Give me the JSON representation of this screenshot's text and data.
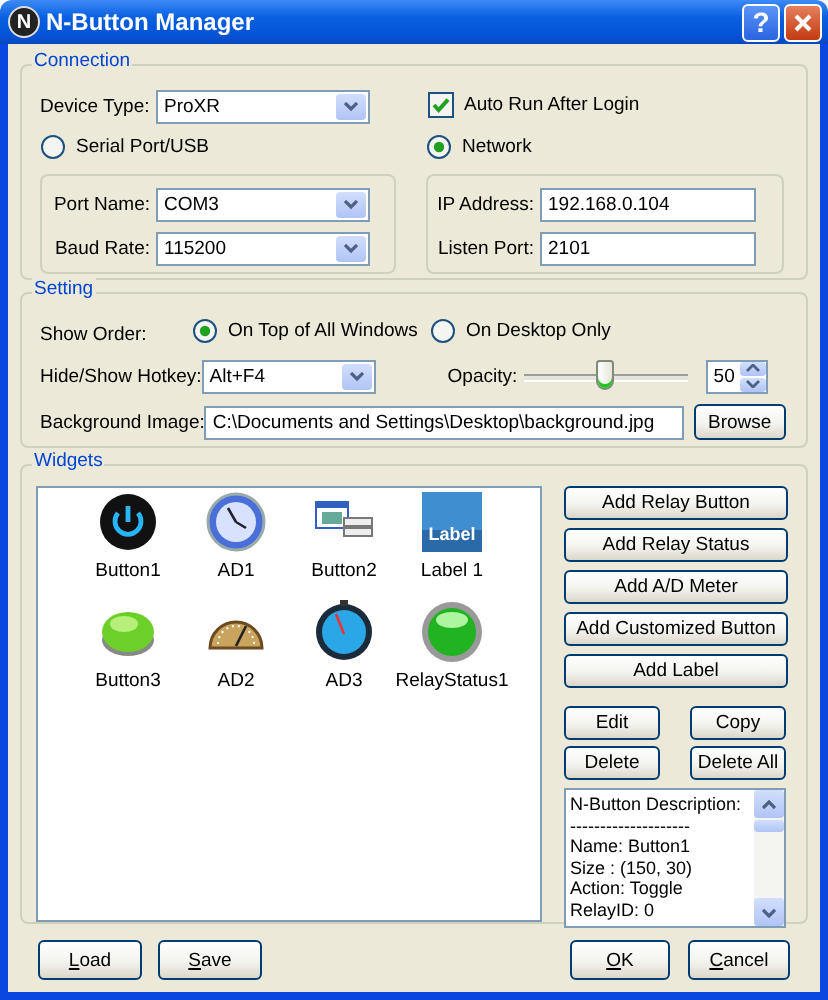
{
  "window": {
    "icon_letter": "N",
    "title": "N-Button Manager",
    "help": "?"
  },
  "connection": {
    "title": "Connection",
    "device_type": {
      "label": "Device Type:",
      "value": "ProXR"
    },
    "auto_run": {
      "label": "Auto Run After Login",
      "checked": true
    },
    "modes": [
      {
        "label": "Serial Port/USB",
        "selected": false
      },
      {
        "label": "Network",
        "selected": true
      }
    ],
    "serial": {
      "port_name": {
        "label": "Port Name:",
        "value": "COM3"
      },
      "baud_rate": {
        "label": "Baud Rate:",
        "value": "115200"
      }
    },
    "network": {
      "ip_address": {
        "label": "IP Address:",
        "value": "192.168.0.104"
      },
      "listen_port": {
        "label": "Listen Port:",
        "value": "2101"
      }
    }
  },
  "setting": {
    "title": "Setting",
    "show_order": {
      "label": "Show Order:",
      "options": [
        {
          "label": "On Top of All Windows",
          "selected": true
        },
        {
          "label": "On Desktop Only",
          "selected": false
        }
      ]
    },
    "hotkey": {
      "label": "Hide/Show Hotkey:",
      "value": "Alt+F4"
    },
    "opacity": {
      "label": "Opacity:",
      "level": 0.5,
      "value": "50"
    },
    "background_image": {
      "label": "Background Image:",
      "value": "C:\\Documents and Settings\\Desktop\\background.jpg",
      "button": "Browse"
    }
  },
  "widgets": {
    "title": "Widgets",
    "items": [
      {
        "label": "Button1",
        "kind": "power"
      },
      {
        "label": "AD1",
        "kind": "clock"
      },
      {
        "label": "Button2",
        "kind": "window"
      },
      {
        "label": "Label 1",
        "kind": "label",
        "icon_text": "Label"
      },
      {
        "label": "Button3",
        "kind": "pushbutton"
      },
      {
        "label": "AD2",
        "kind": "gauge"
      },
      {
        "label": "AD3",
        "kind": "dial"
      },
      {
        "label": "RelayStatus1",
        "kind": "led"
      }
    ],
    "add_buttons": [
      "Add Relay Button",
      "Add Relay Status",
      "Add A/D Meter",
      "Add Customized Button",
      "Add Label"
    ],
    "actions": [
      "Edit",
      "Copy",
      "Delete",
      "Delete All"
    ],
    "description": [
      "N-Button Description:",
      "--------------------",
      "Name: Button1",
      "Size : (150, 30)",
      "Action: Toggle",
      "RelayID: 0"
    ]
  },
  "footer": {
    "left": [
      "Load",
      "Save"
    ],
    "right": [
      "OK",
      "Cancel"
    ]
  }
}
